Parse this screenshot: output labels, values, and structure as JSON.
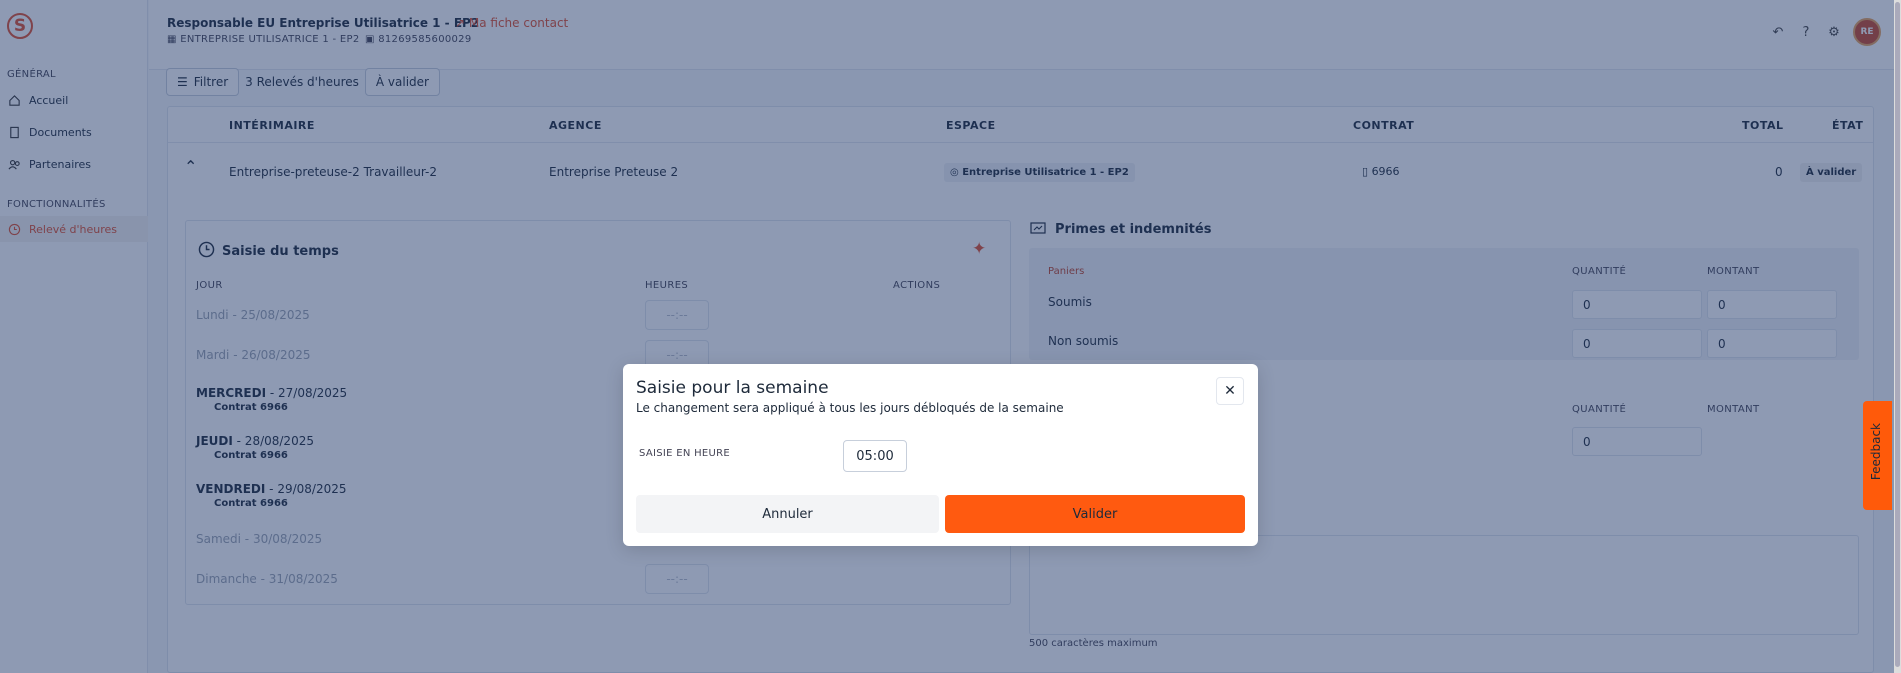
{
  "sidebar": {
    "logo": "S",
    "section_general": "GÉNÉRAL",
    "items": [
      {
        "label": "Accueil",
        "icon": "home-icon"
      },
      {
        "label": "Documents",
        "icon": "document-icon"
      },
      {
        "label": "Partenaires",
        "icon": "partners-icon"
      }
    ],
    "section_features": "FONCTIONNALITÉS",
    "feature_items": [
      {
        "label": "Relevé d'heures",
        "icon": "clock-icon",
        "active": true
      }
    ]
  },
  "header": {
    "title": "Responsable EU Entreprise Utilisatrice 1 - EP2",
    "contact_link": "Ma fiche contact",
    "company": "ENTREPRISE UTILISATRICE 1 - EP2",
    "siret": "81269585600029",
    "avatar_initials": "RE"
  },
  "toolbar": {
    "filter_label": "Filtrer",
    "count_label": "3 Relevés d'heures",
    "status_filter": "À valider"
  },
  "table": {
    "columns": [
      "INTÉRIMAIRE",
      "AGENCE",
      "ESPACE",
      "CONTRAT",
      "TOTAL",
      "ÉTAT"
    ],
    "row": {
      "interimaire": "Entreprise-preteuse-2 Travailleur-2",
      "agence": "Entreprise Preteuse 2",
      "espace": "Entreprise Utilisatrice 1 - EP2",
      "contrat": "6966",
      "total": "0",
      "etat": "À valider"
    }
  },
  "time_panel": {
    "title": "Saisie du temps",
    "col_jour": "JOUR",
    "col_heures": "HEURES",
    "col_actions": "ACTIONS",
    "placeholder": "--:--",
    "days": [
      {
        "label": "Lundi - 25/08/2025",
        "disabled": true
      },
      {
        "label": "Mardi - 26/08/2025",
        "disabled": true
      },
      {
        "day": "MERCREDI",
        "date": " - 27/08/2025",
        "contract": "Contrat 6966"
      },
      {
        "day": "JEUDI",
        "date": " - 28/08/2025",
        "contract": "Contrat 6966"
      },
      {
        "day": "VENDREDI",
        "date": " - 29/08/2025",
        "contract": "Contrat 6966"
      },
      {
        "label": "Samedi - 30/08/2025",
        "disabled": true
      },
      {
        "label": "Dimanche - 31/08/2025",
        "disabled": true
      }
    ]
  },
  "primes": {
    "title": "Primes et indemnités",
    "group": "Paniers",
    "col_quantite": "QUANTITÉ",
    "col_montant": "MONTANT",
    "rows": [
      {
        "label": "Soumis",
        "quantite": "0",
        "montant": "0"
      },
      {
        "label": "Non soumis",
        "quantite": "0",
        "montant": "0"
      }
    ],
    "second_quantite": "0",
    "hint": "500 caractères maximum"
  },
  "modal": {
    "title": "Saisie pour la semaine",
    "subtitle": "Le changement sera appliqué à tous les jours débloqués de la semaine",
    "field_label": "SAISIE EN HEURE",
    "time_value": "05:00",
    "cancel_label": "Annuler",
    "confirm_label": "Valider"
  },
  "feedback_label": "Feedback",
  "colors": {
    "accent": "#ff5a10",
    "brand": "#e0502f",
    "overlay": "#1e3568"
  }
}
